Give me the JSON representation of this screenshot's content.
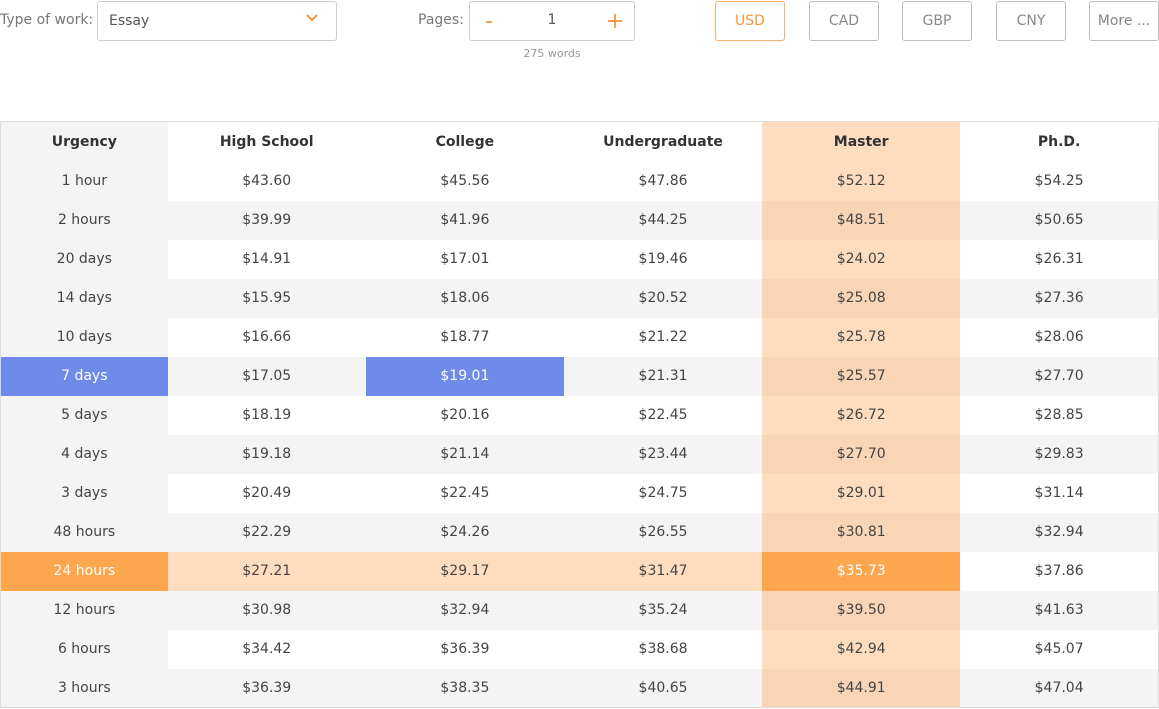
{
  "controls": {
    "type_label": "Type of work:",
    "type_value": "Essay",
    "pages_label": "Pages:",
    "pages_minus": "-",
    "pages_value": "1",
    "pages_plus": "+",
    "words": "275 words",
    "currencies": [
      "USD",
      "CAD",
      "GBP",
      "CNY",
      "More ..."
    ],
    "active_currency": "USD",
    "accent_color": "#f5963c"
  },
  "table": {
    "headers": [
      "Urgency",
      "High School",
      "College",
      "Undergraduate",
      "Master",
      "Ph.D."
    ],
    "rows": [
      {
        "urgency": "1 hour",
        "prices": [
          "$43.60",
          "$45.56",
          "$47.86",
          "$52.12",
          "$54.25"
        ]
      },
      {
        "urgency": "2 hours",
        "prices": [
          "$39.99",
          "$41.96",
          "$44.25",
          "$48.51",
          "$50.65"
        ]
      },
      {
        "urgency": "20 days",
        "prices": [
          "$14.91",
          "$17.01",
          "$19.46",
          "$24.02",
          "$26.31"
        ]
      },
      {
        "urgency": "14 days",
        "prices": [
          "$15.95",
          "$18.06",
          "$20.52",
          "$25.08",
          "$27.36"
        ]
      },
      {
        "urgency": "10 days",
        "prices": [
          "$16.66",
          "$18.77",
          "$21.22",
          "$25.78",
          "$28.06"
        ]
      },
      {
        "urgency": "7 days",
        "prices": [
          "$17.05",
          "$19.01",
          "$21.31",
          "$25.57",
          "$27.70"
        ]
      },
      {
        "urgency": "5 days",
        "prices": [
          "$18.19",
          "$20.16",
          "$22.45",
          "$26.72",
          "$28.85"
        ]
      },
      {
        "urgency": "4 days",
        "prices": [
          "$19.18",
          "$21.14",
          "$23.44",
          "$27.70",
          "$29.83"
        ]
      },
      {
        "urgency": "3 days",
        "prices": [
          "$20.49",
          "$22.45",
          "$24.75",
          "$29.01",
          "$31.14"
        ]
      },
      {
        "urgency": "48 hours",
        "prices": [
          "$22.29",
          "$24.26",
          "$26.55",
          "$30.81",
          "$32.94"
        ]
      },
      {
        "urgency": "24 hours",
        "prices": [
          "$27.21",
          "$29.17",
          "$31.47",
          "$35.73",
          "$37.86"
        ]
      },
      {
        "urgency": "12 hours",
        "prices": [
          "$30.98",
          "$32.94",
          "$35.24",
          "$39.50",
          "$41.63"
        ]
      },
      {
        "urgency": "6 hours",
        "prices": [
          "$34.42",
          "$36.39",
          "$38.68",
          "$42.94",
          "$45.07"
        ]
      },
      {
        "urgency": "3 hours",
        "prices": [
          "$36.39",
          "$38.35",
          "$40.65",
          "$44.91",
          "$47.04"
        ]
      }
    ],
    "selected_row": 5,
    "selected_col": 1,
    "highlight_row": 10,
    "highlight_col": 3,
    "colors": {
      "highlight_strong": "#fca64d",
      "highlight_soft": "#fddcbf",
      "selected": "#6f8ae8"
    }
  }
}
